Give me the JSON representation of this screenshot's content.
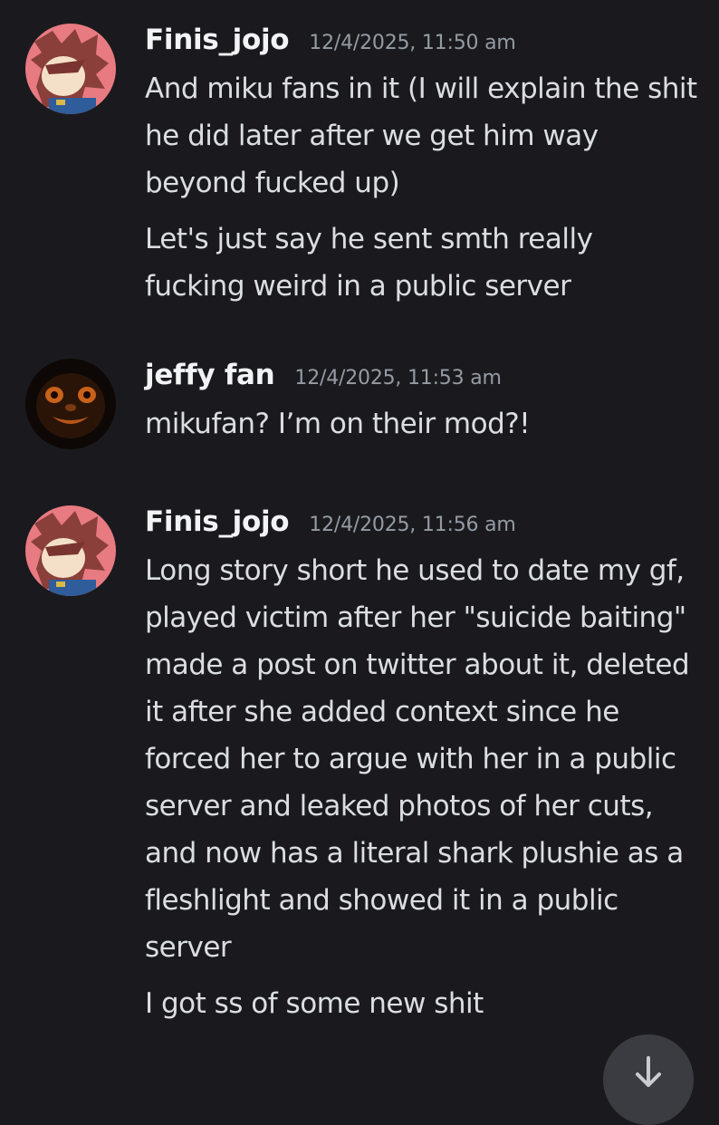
{
  "messages": [
    {
      "username": "Finis_jojo",
      "timestamp": "12/4/2025, 11:50 am",
      "avatar_icon": "anime-character-avatar",
      "lines": [
        "And miku fans in it (I will explain the shit he did later after we get him way beyond fucked up)",
        "Let's just say he sent smth really fucking weird in a public server"
      ]
    },
    {
      "username": "jeffy fan",
      "timestamp": "12/4/2025, 11:53 am",
      "avatar_icon": "dark-creepy-face-avatar",
      "lines": [
        "mikufan? I’m on their mod?!"
      ]
    },
    {
      "username": "Finis_jojo",
      "timestamp": "12/4/2025, 11:56 am",
      "avatar_icon": "anime-character-avatar",
      "lines": [
        "Long story short he used to date my gf, played victim after her \"suicide baiting\" made a post on twitter about it, deleted it after she added context since he forced her to argue with her in a public server and leaked photos of her cuts, and now has a literal shark plushie as a fleshlight and showed it in a public server",
        "I got ss of some new shit"
      ]
    }
  ],
  "scroll_button": {
    "icon": "arrow-down-icon"
  },
  "colors": {
    "background": "#1a1a1e",
    "username": "#f2f3f5",
    "timestamp": "#949ba4",
    "text": "#dbdee1"
  }
}
